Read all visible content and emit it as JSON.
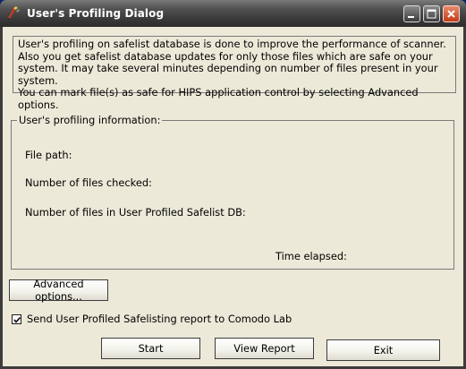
{
  "window": {
    "title": "User's Profiling Dialog",
    "icon": "comodo-app-icon"
  },
  "titlebar_buttons": {
    "minimize": "minimize-icon",
    "maximize": "maximize-icon",
    "close": "close-icon"
  },
  "info": {
    "line1": "User's profiling on safelist database is done to improve the performance of scanner. Also you get safelist database updates for only those files which are safe on your system. It may take several minutes depending on number of files present in your system.",
    "line2": "You can mark file(s) as safe for HIPS application control by selecting Advanced options."
  },
  "profiling_group": {
    "title": "User's profiling information:",
    "file_path_label": "File path:",
    "files_checked_label": "Number of files checked:",
    "files_in_db_label": "Number of files in User Profiled Safelist DB:",
    "time_elapsed_label": "Time elapsed:"
  },
  "advanced_button_label": "Advanced options...",
  "report_checkbox": {
    "label": "Send User Profiled Safelisting report to Comodo Lab",
    "checked": true
  },
  "buttons": {
    "start": "Start",
    "view_report": "View Report",
    "exit": "Exit"
  }
}
